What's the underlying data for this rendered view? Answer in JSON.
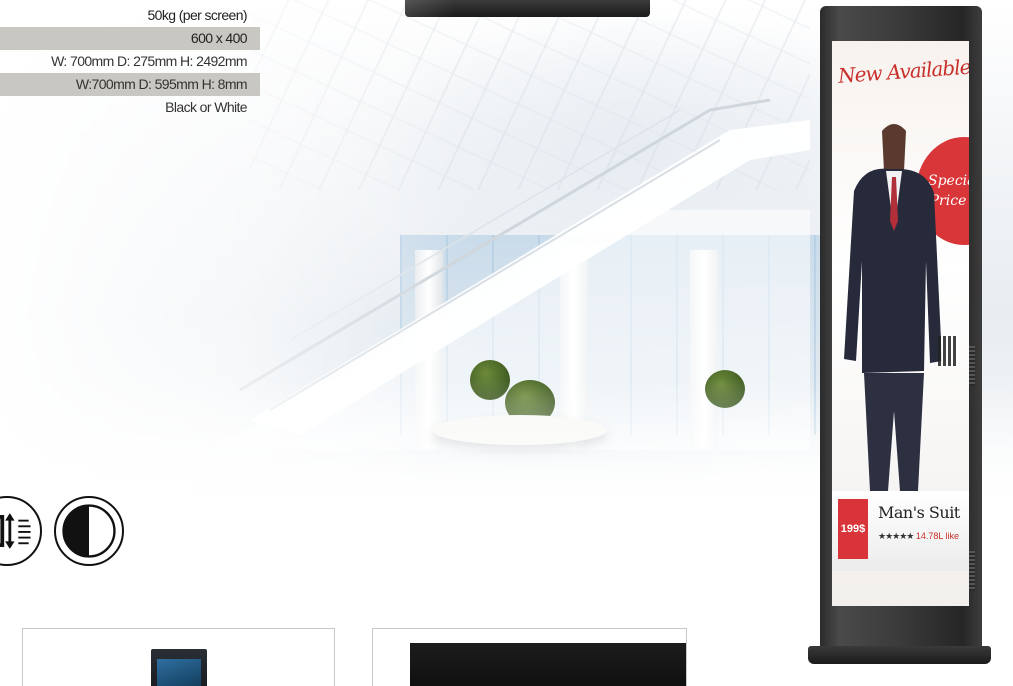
{
  "specs": [
    {
      "value": "50kg (per screen)",
      "shaded": false
    },
    {
      "value": "600 x 400",
      "shaded": true
    },
    {
      "value": "W: 700mm D: 275mm H: 2492mm",
      "shaded": false
    },
    {
      "value": "W:700mm D: 595mm H: 8mm",
      "shaded": true
    },
    {
      "value": "Black or White",
      "shaded": false
    }
  ],
  "icons": [
    {
      "name": "rotation-tilt-icon"
    },
    {
      "name": "black-white-color-icon"
    }
  ],
  "kiosk_screen": {
    "headline": "New Available",
    "badge_line1": "Special",
    "badge_line2": "Price",
    "price": "199$",
    "product_name": "Man's Suit",
    "rating_stars": "★★★★★",
    "likes": "14.78L like"
  },
  "colors": {
    "shaded_row": "#c9c7c1",
    "accent_red": "#d9363a",
    "kiosk_frame": "#2b2b2b"
  }
}
